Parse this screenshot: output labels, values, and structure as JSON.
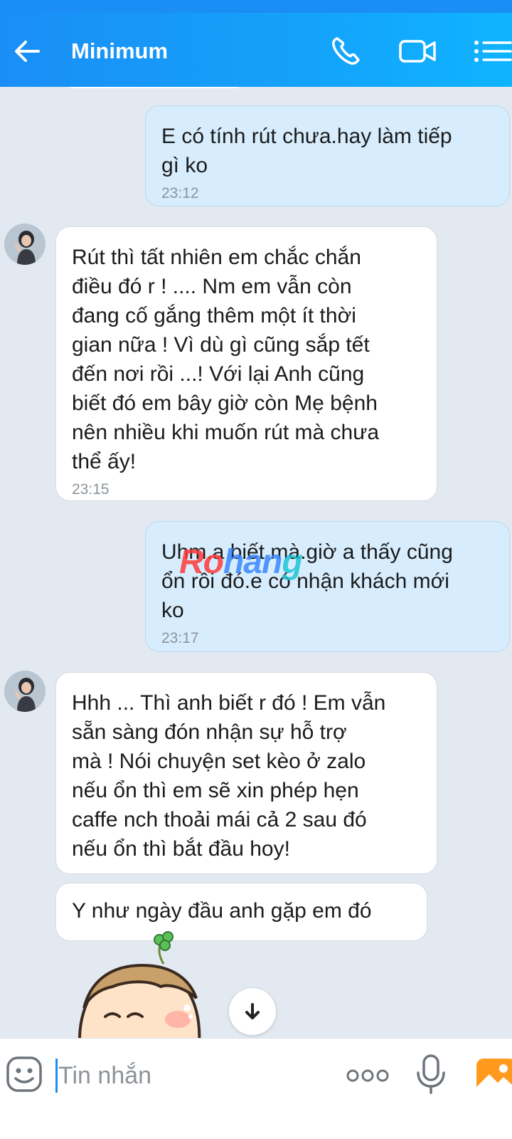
{
  "header": {
    "title": "Minimum"
  },
  "messages": [
    {
      "direction": "out",
      "text": "E có tính rút chưa.hay làm tiếp\ngì ko",
      "time": "23:12"
    },
    {
      "direction": "in",
      "text": "Rút thì tất nhiên em chắc chắn\nđiều đó r ! .... Nm em vẫn còn\nđang cố gắng thêm một ít thời\ngian nữa ! Vì dù gì cũng sắp tết\nđến nơi rồi ...!  Với lại Anh cũng\nbiết đó em bây giờ còn Mẹ bệnh\nnên nhiều khi muốn rút mà chưa\nthể ấy!",
      "time": "23:15"
    },
    {
      "direction": "out",
      "text": "Uhm.a biết mà.giờ a thấy cũng\nổn rồi đó.e có nhận khách mới\nko",
      "time": "23:17"
    },
    {
      "direction": "in",
      "text": "Hhh ... Thì anh biết r đó ! Em vẫn\nsẵn sàng đón nhận sự hỗ trợ\nmà !   Nói chuyện set kèo ở zalo\nnếu ổn thì em sẽ xin phép hẹn\ncaffe nch thoải mái cả 2 sau đó\nnếu ổn thì bắt đầu hoy!"
    },
    {
      "direction": "in",
      "text": "Y như ngày đầu anh gặp em đó"
    }
  ],
  "watermark": {
    "part1": "Ro",
    "part2": "han",
    "part3": "g"
  },
  "composer": {
    "placeholder": "Tin nhắn"
  },
  "colors": {
    "header": "#1a8ef5",
    "outgoing_bubble": "#d7edfd",
    "incoming_bubble": "#ffffff",
    "background": "#e2e9f1",
    "timestamp": "#8b949c"
  },
  "icons": {
    "back": "arrow-left",
    "call": "phone",
    "video": "video-camera",
    "menu": "list",
    "emoji": "smiley",
    "more": "three-dots",
    "mic": "microphone",
    "photo": "image",
    "scroll": "arrow-down"
  }
}
